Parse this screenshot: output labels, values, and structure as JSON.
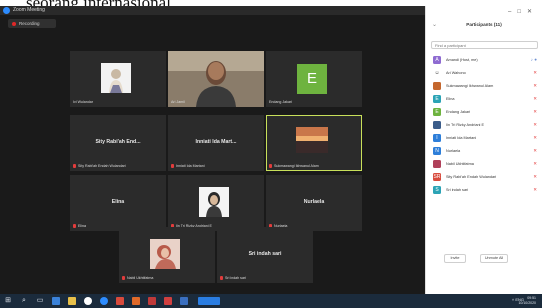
{
  "caption": {
    "text": "seorang internasional."
  },
  "titlebar": {
    "title": "Zoom Meeting"
  },
  "recording": {
    "label": "Recording"
  },
  "tiles": [
    {
      "id": "t1",
      "bottom": "Ivi Wulandar",
      "center": "",
      "kind": "photo",
      "active": false
    },
    {
      "id": "t2",
      "bottom": "Ari Jamil",
      "center": "",
      "kind": "video",
      "active": false
    },
    {
      "id": "t3",
      "bottom": "Endang Jakari",
      "center": "",
      "kind": "letter",
      "letter": "E",
      "active": false
    },
    {
      "id": "t4",
      "bottom": "Sity Rabi'ah Endah Wulandari",
      "center": "Sity Rabi'ah End...",
      "kind": "name",
      "active": false
    },
    {
      "id": "t5",
      "bottom": "Inniati Ida Martani",
      "center": "Inniati Ida Mart...",
      "kind": "name",
      "active": false
    },
    {
      "id": "t6",
      "bottom": "Sukmawangi Ikhwanul Alam",
      "center": "",
      "kind": "sunset",
      "active": true
    },
    {
      "id": "t7",
      "bottom": "Elina",
      "center": "Elina",
      "kind": "name",
      "active": false
    },
    {
      "id": "t8",
      "bottom": "Iin Tri Rizky Andriani E",
      "center": "",
      "kind": "photo2",
      "active": false
    },
    {
      "id": "t9",
      "bottom": "Nurlaela",
      "center": "Nurlaela",
      "kind": "name",
      "active": false
    },
    {
      "id": "t10",
      "bottom": "Nabil Ukhtifatma",
      "center": "",
      "kind": "photo3",
      "active": false
    },
    {
      "id": "t11",
      "bottom": "Sri indah sari",
      "center": "Sri indah sari",
      "kind": "name",
      "active": false
    }
  ],
  "panel": {
    "title": "Participants (11)",
    "search_placeholder": "Find a participant",
    "invite_label": "Invite",
    "unmute_label": "Unmute All",
    "participants": [
      {
        "name": "Amandi (Host, me)",
        "color": "#8e6bd1",
        "initial": "A",
        "status": "♪ ●"
      },
      {
        "name": "Ari Wahono",
        "color": "#ffffff",
        "initial": "☺",
        "status": "✕"
      },
      {
        "name": "Sukmawangi Ikhwanul Alam",
        "color": "#c4672e",
        "initial": "",
        "status": "✕"
      },
      {
        "name": "Elina",
        "color": "#2ba3b5",
        "initial": "E",
        "status": "✕"
      },
      {
        "name": "Endang Jakari",
        "color": "#6eb33f",
        "initial": "E",
        "status": "✕"
      },
      {
        "name": "Iin Tri Rizky Andriani E",
        "color": "#3b5d8a",
        "initial": "",
        "status": "✕"
      },
      {
        "name": "Inniati Ida Martani",
        "color": "#2d7ed9",
        "initial": "I",
        "status": "✕"
      },
      {
        "name": "Nurlaela",
        "color": "#2d7ed9",
        "initial": "N",
        "status": "✕"
      },
      {
        "name": "Nabil Ukhtifatma",
        "color": "#b0405a",
        "initial": "",
        "status": "✕"
      },
      {
        "name": "Sity Rabi'ah Endah Wulandari",
        "color": "#d84a3c",
        "initial": "SR",
        "status": "✕"
      },
      {
        "name": "Sri indah sari",
        "color": "#2ba3b5",
        "initial": "S",
        "status": "✕"
      }
    ]
  },
  "tray": {
    "text": "˄ ENG",
    "time": "09:51",
    "date": "10/10/2020"
  }
}
